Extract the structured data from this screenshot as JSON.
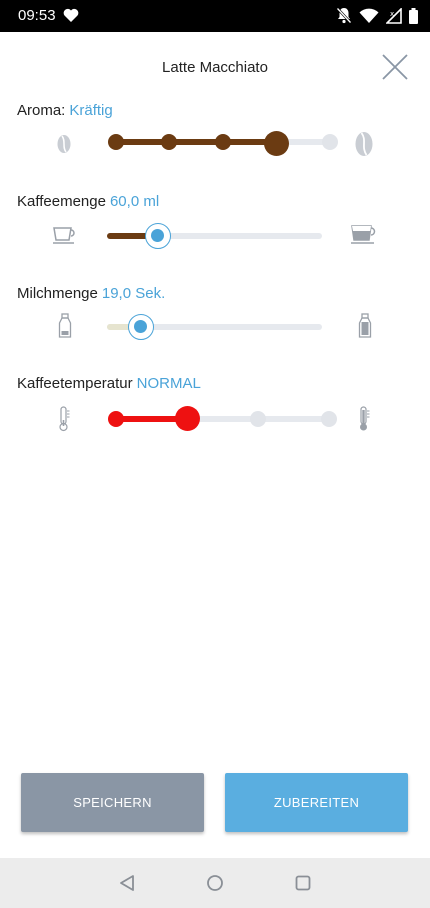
{
  "status_bar": {
    "time": "09:53"
  },
  "header": {
    "title": "Latte Macchiato"
  },
  "settings": {
    "aroma": {
      "label": "Aroma:",
      "value": "Kräftig",
      "level": 4,
      "levels": 5
    },
    "coffee_amount": {
      "label": "Kaffeemenge",
      "value": "60,0 ml",
      "fraction": 0.22
    },
    "milk_amount": {
      "label": "Milchmenge",
      "value": "19,0 Sek.",
      "fraction": 0.15
    },
    "temperature": {
      "label": "Kaffeetemperatur",
      "value": "NORMAL",
      "level": 2,
      "levels": 4
    }
  },
  "colors": {
    "accent_blue": "#4aa3d8",
    "coffee_brown": "#6b3b12",
    "temperature_red": "#ee1111",
    "track_grey": "#e6e9ee",
    "save_button": "#8a96a5",
    "prepare_button": "#5aaee0"
  },
  "buttons": {
    "save": "SPEICHERN",
    "prepare": "ZUBEREITEN"
  },
  "icons": [
    "heart-icon",
    "bell-off-icon",
    "wifi-icon",
    "signal-icon",
    "battery-icon",
    "close-icon",
    "coffee-bean-icon",
    "cup-icon",
    "milk-bottle-icon",
    "thermometer-icon",
    "back-icon",
    "home-icon",
    "recents-icon"
  ]
}
